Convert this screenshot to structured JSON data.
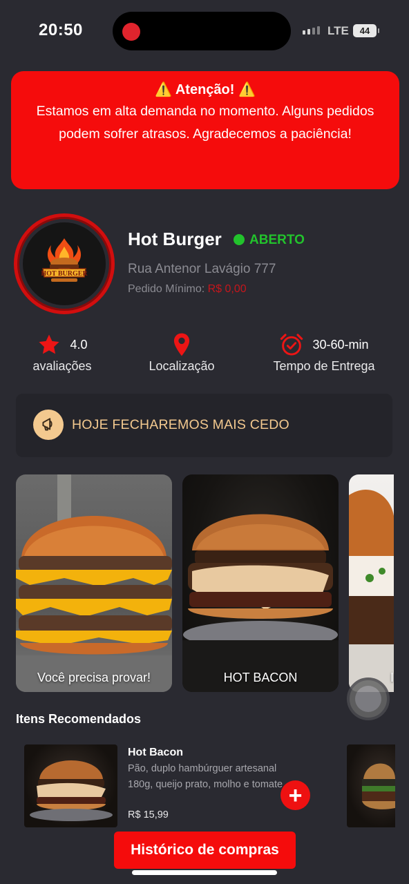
{
  "status_bar": {
    "time": "20:50",
    "network": "LTE",
    "battery": "44"
  },
  "alert": {
    "title": "⚠️ Atenção! ⚠️",
    "message": "Estamos em alta demanda no momento. Alguns pedidos podem sofrer atrasos. Agradecemos a paciência!",
    "color": "#f50c0c"
  },
  "restaurant": {
    "logo_text": "HOT BURGER",
    "name": "Hot Burger",
    "status": "ABERTO",
    "address": "Rua Antenor Lavágio 777",
    "min_order_label": "Pedido Mínimo:",
    "min_order_value": "R$ 0,00"
  },
  "info": {
    "rating_value": "4.0",
    "rating_label": "avaliações",
    "location_label": "Localização",
    "delivery_time": "30-60-min",
    "delivery_label": "Tempo de Entrega"
  },
  "notice": {
    "text": "HOJE FECHAREMOS MAIS CEDO"
  },
  "carousel": [
    {
      "caption": "Você precisa provar!"
    },
    {
      "caption": "HOT BACON"
    },
    {
      "caption": "I"
    }
  ],
  "recommended": {
    "title": "Itens Recomendados",
    "items": [
      {
        "name": "Hot Bacon",
        "description": "Pão, duplo hambúrguer artesanal 180g, queijo prato, molho e tomate",
        "price": "R$ 15,99",
        "add_label": "+"
      }
    ]
  },
  "history_button": "Histórico de compras",
  "colors": {
    "background": "#2a2a31",
    "accent": "#f50c0c",
    "open": "#22c32c",
    "notice": "#f3c98f"
  }
}
